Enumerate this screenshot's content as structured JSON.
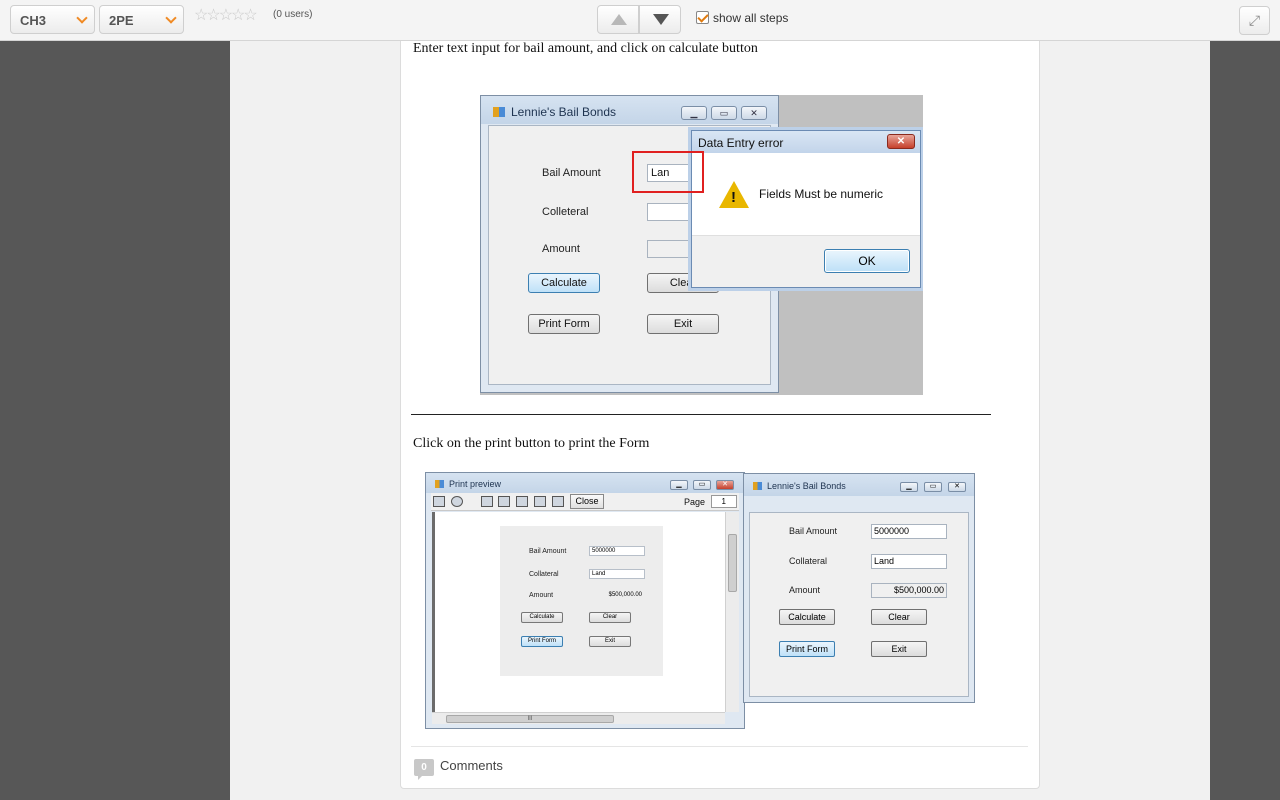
{
  "toolbar": {
    "chapter_select": "CH3",
    "section_select": "2PE",
    "rating_stars": "☆☆☆☆☆",
    "users": "(0 users)",
    "show_all_steps": "show all steps",
    "fullscreen_icon": "fullscreen-icon"
  },
  "steps": {
    "step1_text": "Enter text input for bail amount, and click  on calculate button",
    "step2_text": "Click on the print button to print  the Form"
  },
  "shot1": {
    "window_title": "Lennie's Bail Bonds",
    "labels": {
      "bail": "Bail Amount",
      "collateral": "Colleteral",
      "amount": "Amount"
    },
    "bail_value": "Lan",
    "buttons": {
      "calculate": "Calculate",
      "clear": "Clear",
      "print": "Print Form",
      "exit": "Exit"
    },
    "dialog": {
      "title": "Data Entry error",
      "message": "Fields Must be numeric",
      "ok": "OK",
      "close": "✕"
    }
  },
  "shot2": {
    "preview_title": "Print preview",
    "close_label": "Close",
    "page_label": "Page",
    "page_value": "1",
    "scroll_grip": "III",
    "form_title": "Lennie's Bail Bonds",
    "labels": {
      "bail": "Bail Amount",
      "collateral": "Collateral",
      "amount": "Amount"
    },
    "values": {
      "bail": "5000000",
      "collateral": "Land",
      "amount": "$500,000.00"
    },
    "buttons": {
      "calculate": "Calculate",
      "clear": "Clear",
      "print": "Print Form",
      "exit": "Exit"
    }
  },
  "comments": {
    "count": "0",
    "label": "Comments"
  },
  "window_controls": {
    "minimize": "▁",
    "restore": "▭",
    "close": "✕"
  }
}
